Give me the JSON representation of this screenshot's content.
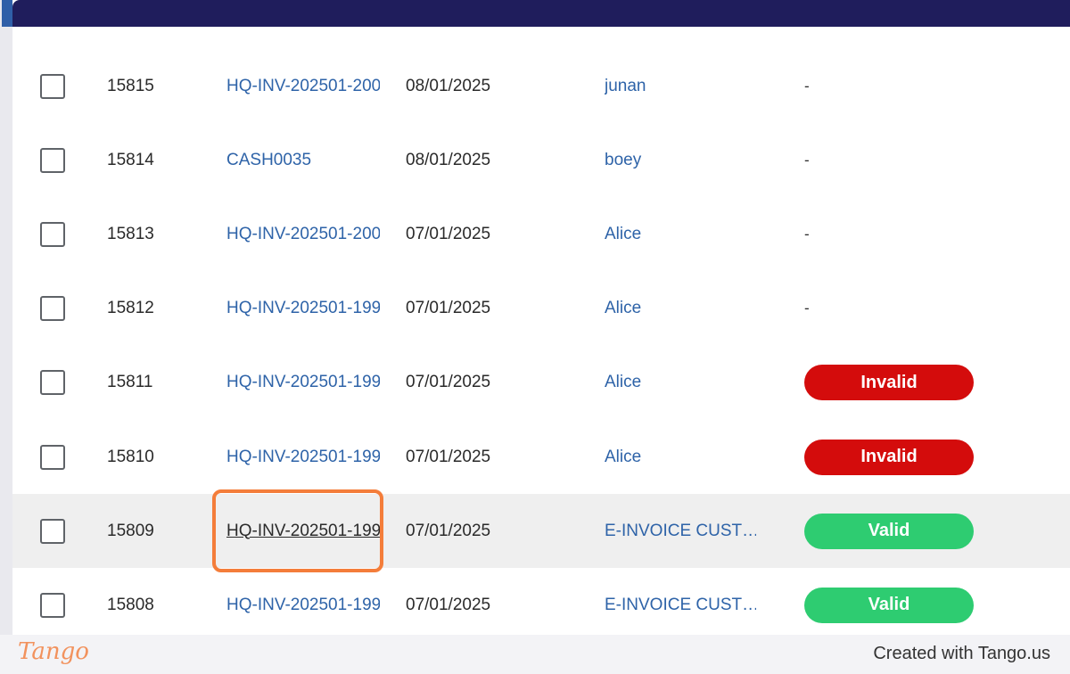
{
  "table": {
    "rows": [
      {
        "id": "15815",
        "ref": "HQ-INV-202501-200",
        "date": "08/01/2025",
        "user": "junan",
        "status": "-",
        "status_type": "none",
        "highlighted": false
      },
      {
        "id": "15814",
        "ref": "CASH0035",
        "date": "08/01/2025",
        "user": "boey",
        "status": "-",
        "status_type": "none",
        "highlighted": false
      },
      {
        "id": "15813",
        "ref": "HQ-INV-202501-200",
        "date": "07/01/2025",
        "user": "Alice",
        "status": "-",
        "status_type": "none",
        "highlighted": false
      },
      {
        "id": "15812",
        "ref": "HQ-INV-202501-199",
        "date": "07/01/2025",
        "user": "Alice",
        "status": "-",
        "status_type": "none",
        "highlighted": false
      },
      {
        "id": "15811",
        "ref": "HQ-INV-202501-199",
        "date": "07/01/2025",
        "user": "Alice",
        "status": "Invalid",
        "status_type": "invalid",
        "highlighted": false
      },
      {
        "id": "15810",
        "ref": "HQ-INV-202501-199",
        "date": "07/01/2025",
        "user": "Alice",
        "status": "Invalid",
        "status_type": "invalid",
        "highlighted": false
      },
      {
        "id": "15809",
        "ref": "HQ-INV-202501-199",
        "date": "07/01/2025",
        "user": "E-INVOICE CUST…",
        "status": "Valid",
        "status_type": "valid",
        "highlighted": true
      },
      {
        "id": "15808",
        "ref": "HQ-INV-202501-199",
        "date": "07/01/2025",
        "user": "E-INVOICE CUST…",
        "status": "Valid",
        "status_type": "valid",
        "highlighted": false
      }
    ]
  },
  "colors": {
    "header": "#1f1d5c",
    "link": "#2e63a8",
    "invalid": "#d40c0c",
    "valid": "#2ecc71",
    "focus_outline": "#f47d3a"
  },
  "footer": {
    "logo": "Tango",
    "created_with": "Created with Tango.us"
  }
}
